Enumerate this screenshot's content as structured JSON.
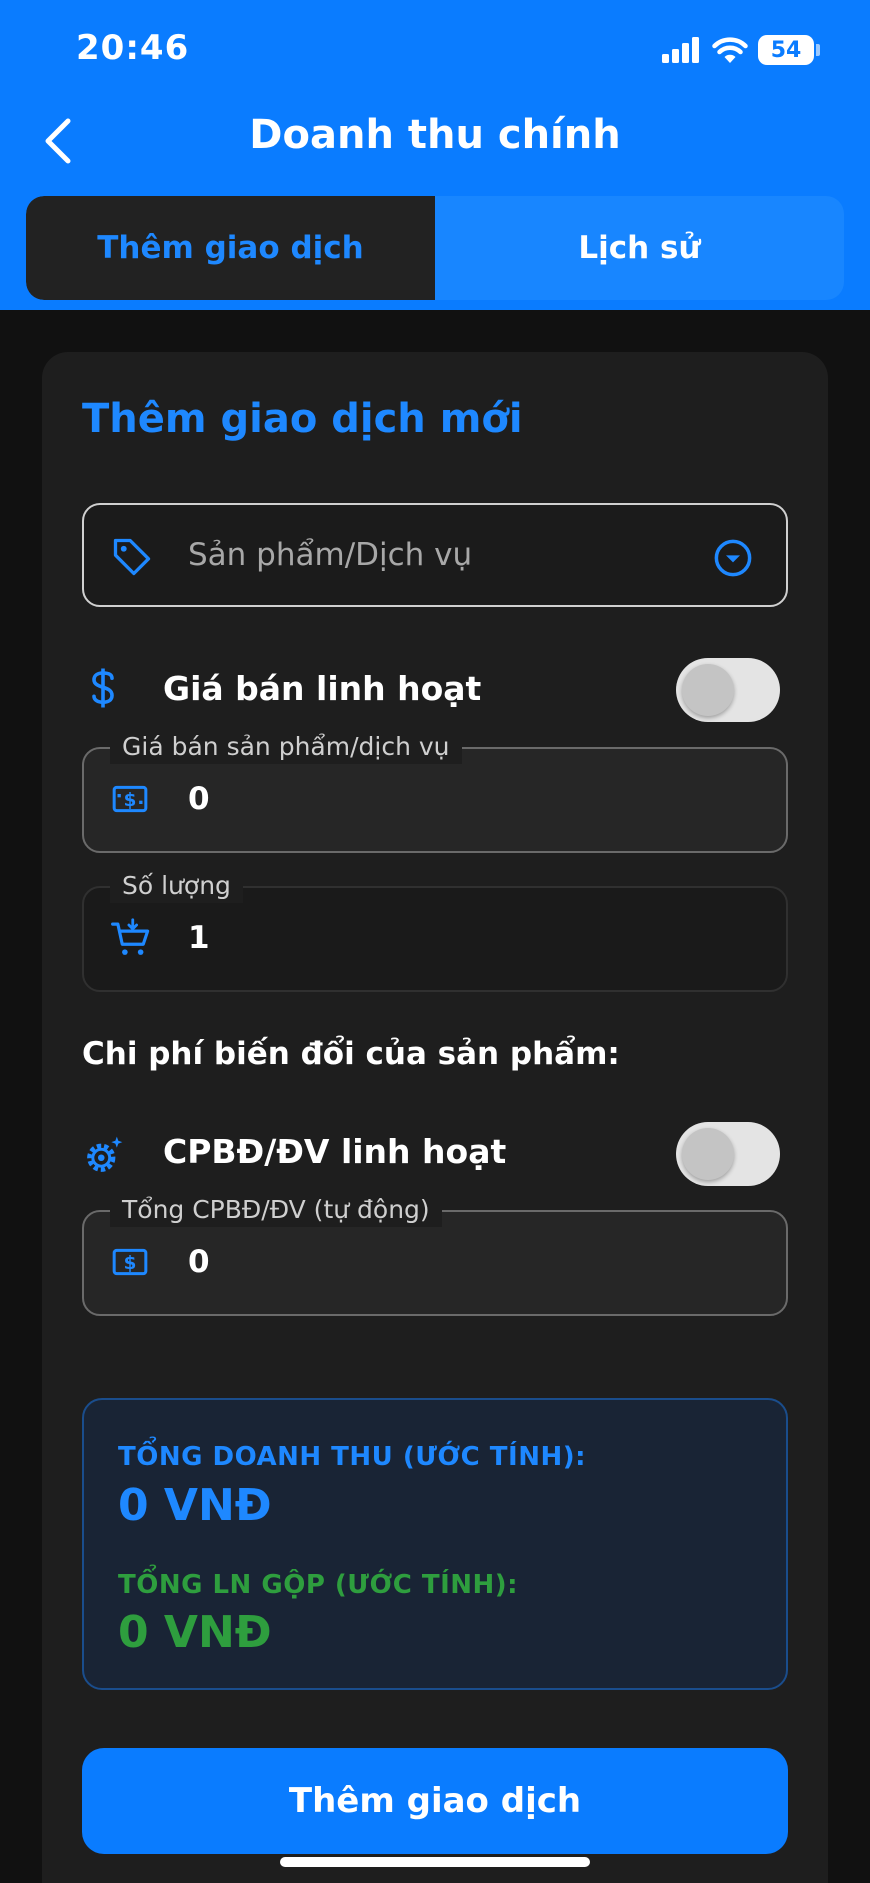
{
  "status_bar": {
    "time": "20:46",
    "battery": "54"
  },
  "header": {
    "title": "Doanh thu chính"
  },
  "tabs": [
    {
      "label": "Thêm giao dịch",
      "active": true
    },
    {
      "label": "Lịch sử",
      "active": false
    }
  ],
  "form": {
    "title": "Thêm giao dịch mới",
    "product_select": {
      "placeholder": "Sản phẩm/Dịch vụ",
      "icon": "tag-icon"
    },
    "flexible_price": {
      "label": "Giá bán linh hoạt",
      "enabled": false,
      "icon": "dollar-icon"
    },
    "price_field": {
      "label": "Giá bán sản phẩm/dịch vụ",
      "value": "0",
      "icon": "money-icon"
    },
    "quantity_field": {
      "label": "Số lượng",
      "value": "1",
      "icon": "cart-icon"
    },
    "variable_cost_section": "Chi phí biến đổi của sản phẩm:",
    "flexible_cost": {
      "label": "CPBĐ/ĐV linh hoạt",
      "enabled": false,
      "icon": "gear-icon"
    },
    "total_cost_field": {
      "label": "Tổng CPBĐ/ĐV (tự động)",
      "value": "0",
      "icon": "money-icon"
    }
  },
  "summary": {
    "revenue_label": "TỔNG DOANH THU (ƯỚC TÍNH):",
    "revenue_value": "0 VNĐ",
    "profit_label": "TỔNG LN GỘP (ƯỚC TÍNH):",
    "profit_value": "0 VNĐ"
  },
  "submit_label": "Thêm giao dịch",
  "colors": {
    "primary": "#0a7cff",
    "accent_text": "#1e88ff",
    "profit": "#2e9e3e",
    "card_bg": "#1e1e1e",
    "page_bg": "#111111"
  }
}
